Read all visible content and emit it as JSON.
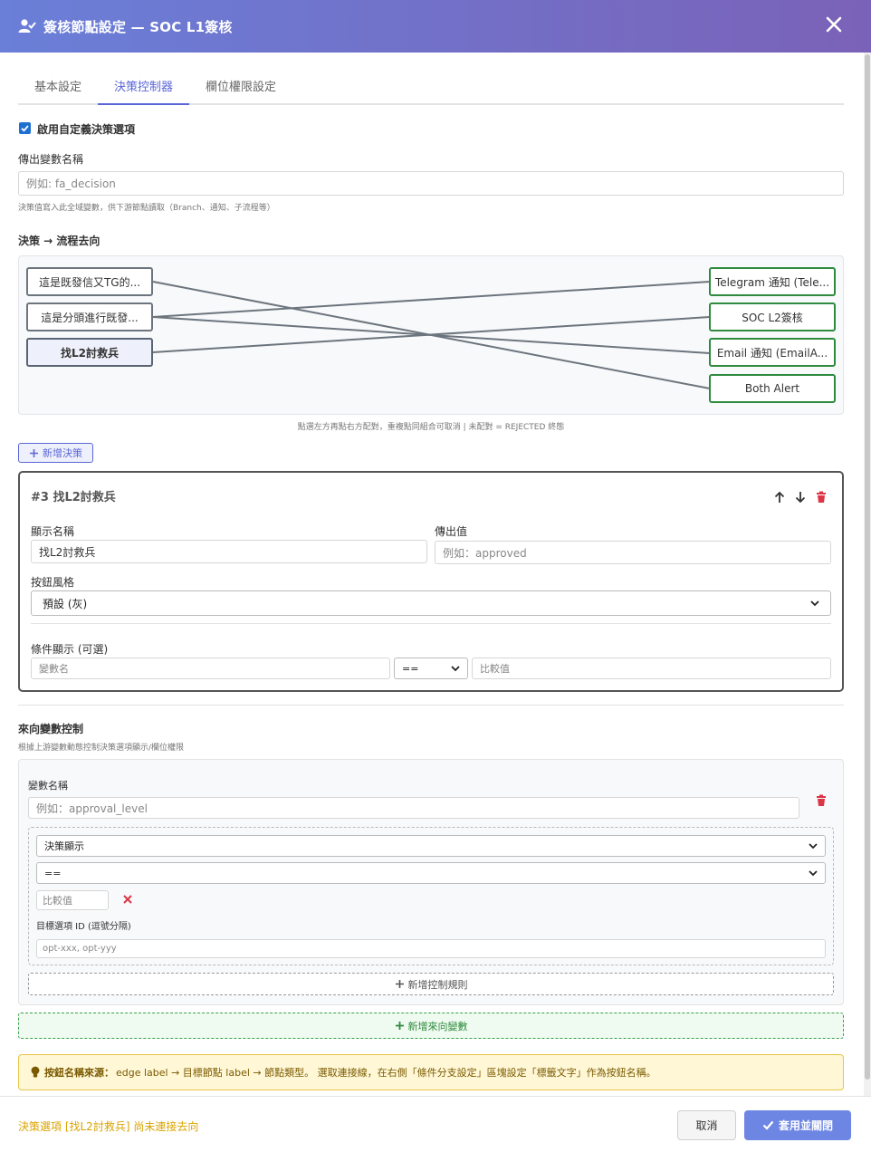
{
  "header": {
    "title": "簽核節點設定 — SOC L1簽核"
  },
  "tabs": [
    {
      "label": "基本設定"
    },
    {
      "label": "決策控制器"
    },
    {
      "label": "欄位權限設定"
    }
  ],
  "enable_custom": {
    "label": "啟用自定義決策選項",
    "checked": true
  },
  "output_var": {
    "label": "傳出變數名稱",
    "placeholder": "例如: fa_decision",
    "hint": "決策值寫入此全域變數，供下游節點讀取（Branch、通知、子流程等）"
  },
  "flow": {
    "label": "決策 → 流程去向",
    "left_nodes": [
      "這是既發信又TG的...",
      "這是分頭進行既發...",
      "找L2討救兵"
    ],
    "right_nodes": [
      "Telegram 通知 (Tele...",
      "SOC L2簽核",
      "Email 通知 (EmailA...",
      "Both Alert"
    ],
    "hint": "點選左方再點右方配對，重複點同組合可取消 | 未配對 = REJECTED 終態"
  },
  "add_decision": {
    "label": "新增決策"
  },
  "decision_card": {
    "title": "#3 找L2討救兵",
    "display_name_label": "顯示名稱",
    "display_name_value": "找L2討救兵",
    "output_value_label": "傳出值",
    "output_value_placeholder": "例如：approved",
    "style_label": "按鈕風格",
    "style_value": "預設 (灰)",
    "condition_label": "條件顯示 (可選)",
    "cond_var_placeholder": "變數名",
    "cond_op": "==",
    "cond_val_placeholder": "比較值"
  },
  "incoming": {
    "label": "來向變數控制",
    "hint": "根據上游變數動態控制決策選項顯示/欄位權限",
    "var_label": "變數名稱",
    "var_placeholder": "例如：approval_level",
    "rule_type": "決策顯示",
    "rule_op": "==",
    "rule_val_placeholder": "比較值",
    "target_label": "目標選項 ID (逗號分隔)",
    "target_placeholder": "opt-xxx, opt-yyy",
    "add_rule": "新增控制規則",
    "add_var": "新增來向變數"
  },
  "note": {
    "bold": "按鈕名稱來源：",
    "text": "edge label → 目標節點 label → 節點類型。 選取連接線，在右側「條件分支設定」區塊設定「標籤文字」作為按鈕名稱。"
  },
  "footer": {
    "warning": "決策選項 [找L2討救兵] 尚未連接去向",
    "cancel": "取消",
    "ok": "套用並關閉"
  },
  "colors": {
    "accent": "#5a67d8",
    "header_start": "#6a7fd8",
    "header_end": "#7a62b8",
    "success": "#2e8b3e",
    "danger": "#dc3545",
    "warning_text": "#d9a400"
  }
}
